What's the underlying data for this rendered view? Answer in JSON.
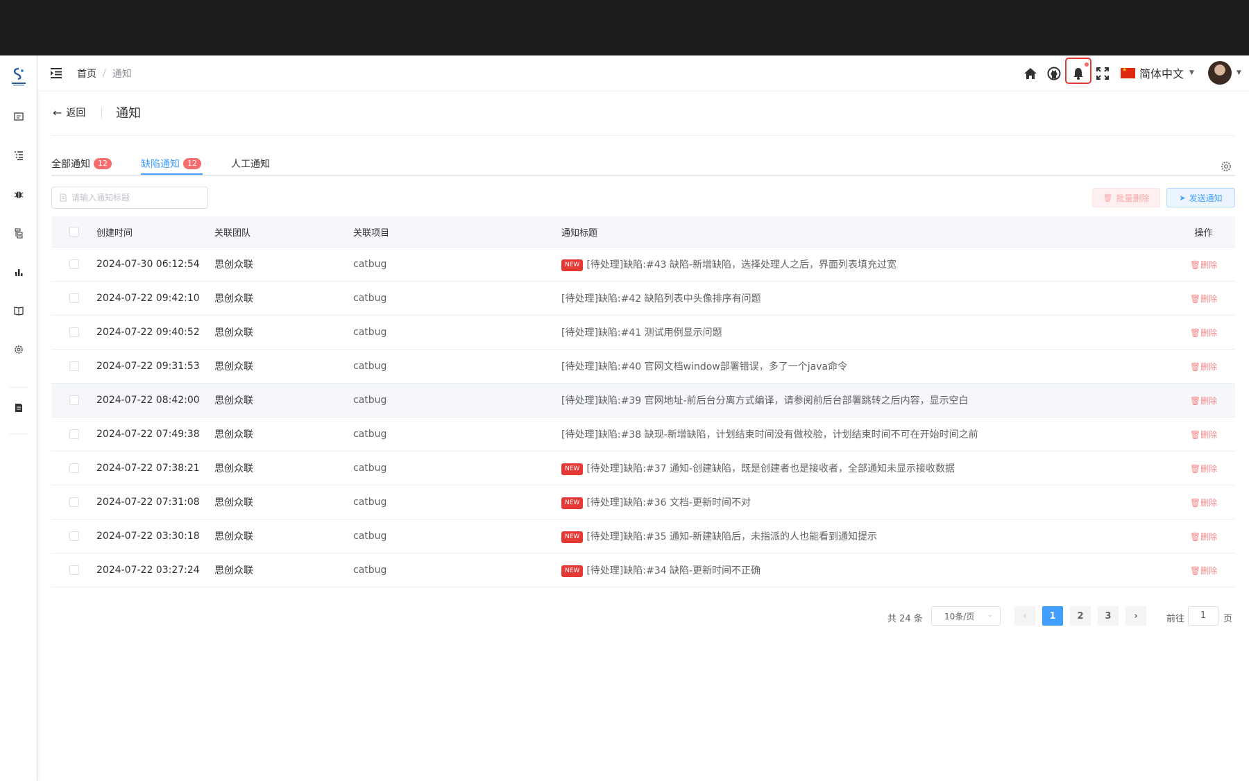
{
  "header": {
    "breadcrumb_home": "首页",
    "breadcrumb_sep": "/",
    "breadcrumb_current": "通知",
    "language": "简体中文"
  },
  "page": {
    "back_label": "返回",
    "title": "通知"
  },
  "tabs": [
    {
      "label": "全部通知",
      "badge": "12"
    },
    {
      "label": "缺陷通知",
      "badge": "12",
      "active": true
    },
    {
      "label": "人工通知"
    }
  ],
  "toolbar": {
    "search_placeholder": "请输入通知标题",
    "batch_delete": "批量删除",
    "send_notice": "发送通知"
  },
  "table": {
    "columns": [
      "创建时间",
      "关联团队",
      "关联项目",
      "通知标题",
      "操作"
    ],
    "new_tag": "NEW",
    "delete_label": "删除",
    "rows": [
      {
        "time": "2024-07-30 06:12:54",
        "team": "思创众联",
        "project": "catbug",
        "is_new": true,
        "title": "[待处理]缺陷:#43 缺陷-新增缺陷，选择处理人之后，界面列表填充过宽"
      },
      {
        "time": "2024-07-22 09:42:10",
        "team": "思创众联",
        "project": "catbug",
        "is_new": false,
        "title": "[待处理]缺陷:#42 缺陷列表中头像排序有问题"
      },
      {
        "time": "2024-07-22 09:40:52",
        "team": "思创众联",
        "project": "catbug",
        "is_new": false,
        "title": "[待处理]缺陷:#41 测试用例显示问题"
      },
      {
        "time": "2024-07-22 09:31:53",
        "team": "思创众联",
        "project": "catbug",
        "is_new": false,
        "title": "[待处理]缺陷:#40 官网文档window部署错误，多了一个java命令"
      },
      {
        "time": "2024-07-22 08:42:00",
        "team": "思创众联",
        "project": "catbug",
        "is_new": false,
        "title": "[待处理]缺陷:#39 官网地址-前后台分离方式编译，请参阅前后台部署跳转之后内容，显示空白"
      },
      {
        "time": "2024-07-22 07:49:38",
        "team": "思创众联",
        "project": "catbug",
        "is_new": false,
        "title": "[待处理]缺陷:#38 缺现-新增缺陷，计划结束时间没有做校验，计划结束时间不可在开始时间之前"
      },
      {
        "time": "2024-07-22 07:38:21",
        "team": "思创众联",
        "project": "catbug",
        "is_new": true,
        "title": "[待处理]缺陷:#37 通知-创建缺陷，既是创建者也是接收者，全部通知未显示接收数据"
      },
      {
        "time": "2024-07-22 07:31:08",
        "team": "思创众联",
        "project": "catbug",
        "is_new": true,
        "title": "[待处理]缺陷:#36 文档-更新时间不对"
      },
      {
        "time": "2024-07-22 03:30:18",
        "team": "思创众联",
        "project": "catbug",
        "is_new": true,
        "title": "[待处理]缺陷:#35 通知-新建缺陷后，未指派的人也能看到通知提示"
      },
      {
        "time": "2024-07-22 03:27:24",
        "team": "思创众联",
        "project": "catbug",
        "is_new": true,
        "title": "[待处理]缺陷:#34 缺陷-更新时间不正确"
      }
    ]
  },
  "pagination": {
    "total_text": "共 24 条",
    "page_size": "10条/页",
    "pages": [
      "1",
      "2",
      "3"
    ],
    "current_page": 1,
    "goto_prefix": "前往",
    "goto_value": "1",
    "goto_suffix": "页"
  },
  "colors": {
    "primary": "#409eff",
    "danger": "#f56c6c",
    "new_tag": "#e53935"
  },
  "icons": {
    "sidebar": [
      "project-icon",
      "list-icon",
      "bug-icon",
      "tree-icon",
      "chart-icon",
      "book-icon",
      "settings-icon",
      "document-icon"
    ],
    "header": [
      "home-icon",
      "github-icon",
      "bell-icon",
      "fullscreen-icon"
    ]
  }
}
